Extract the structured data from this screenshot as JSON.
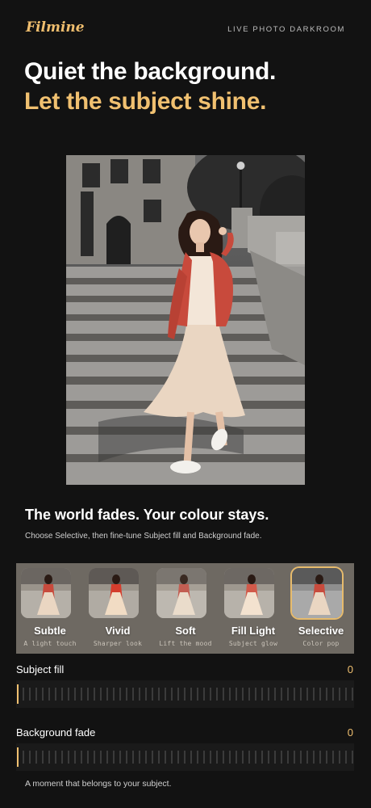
{
  "header": {
    "brand": "Filmine",
    "tagline": "LIVE PHOTO DARKROOM"
  },
  "hero": {
    "line1": "Quiet the background.",
    "line2": "Let the subject shine."
  },
  "photo": {
    "description_icon": "photo-icon"
  },
  "section": {
    "title": "The world fades. Your colour stays.",
    "subtitle": "Choose Selective, then fine-tune Subject fill and Background fade."
  },
  "presets": [
    {
      "name": "Subtle",
      "desc": "A light touch",
      "selected": false
    },
    {
      "name": "Vivid",
      "desc": "Sharper look",
      "selected": false
    },
    {
      "name": "Soft",
      "desc": "Lift the mood",
      "selected": false
    },
    {
      "name": "Fill Light",
      "desc": "Subject glow",
      "selected": false
    },
    {
      "name": "Selective",
      "desc": "Color pop",
      "selected": true
    }
  ],
  "sliders": {
    "subject_fill": {
      "label": "Subject fill",
      "value": "0"
    },
    "background_fade": {
      "label": "Background fade",
      "value": "0"
    }
  },
  "footer": {
    "text": "A moment that belongs to your subject."
  },
  "colors": {
    "accent": "#f0c070",
    "background": "#121212",
    "cardigan": "#c84a3c"
  }
}
